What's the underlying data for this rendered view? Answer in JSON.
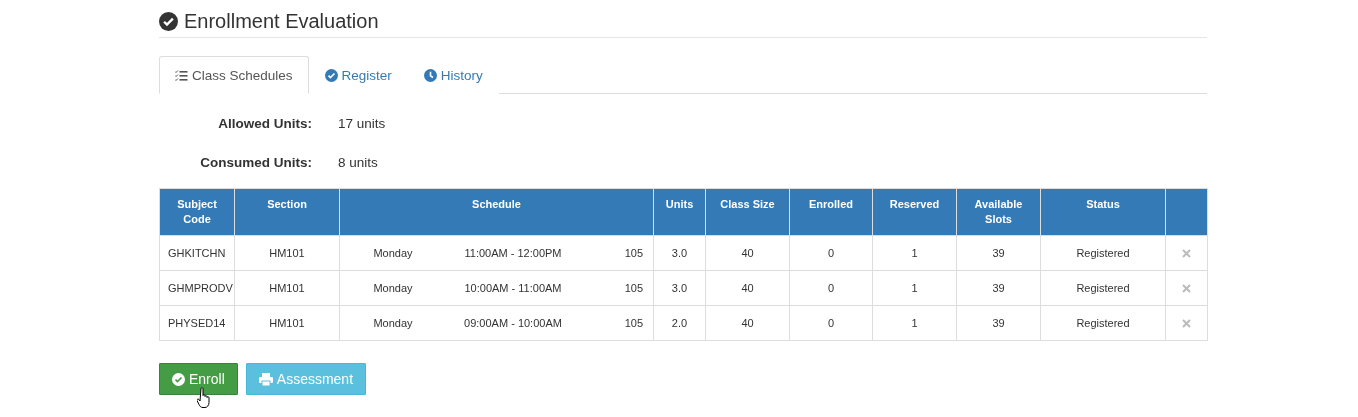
{
  "title": "Enrollment Evaluation",
  "tabs": [
    {
      "label": "Class Schedules",
      "kind": "list",
      "selected": true
    },
    {
      "label": "Register",
      "kind": "check",
      "selected": false
    },
    {
      "label": "History",
      "kind": "clock",
      "selected": false
    }
  ],
  "summary": [
    {
      "label": "Allowed Units:",
      "value": "17 units"
    },
    {
      "label": "Consumed Units:",
      "value": "8 units"
    }
  ],
  "table": {
    "columns": [
      "Subject Code",
      "Section",
      "Schedule",
      "Units",
      "Class Size",
      "Enrolled",
      "Reserved",
      "Available Slots",
      "Status"
    ],
    "rows": [
      {
        "subject_code": "GHKITCHN",
        "section": "HM101",
        "day": "Monday",
        "time": "11:00AM - 12:00PM",
        "room": "105",
        "units": "3.0",
        "class_size": "40",
        "enrolled": "0",
        "reserved": "1",
        "available_slots": "39",
        "status": "Registered"
      },
      {
        "subject_code": "GHMPRODV",
        "section": "HM101",
        "day": "Monday",
        "time": "10:00AM - 11:00AM",
        "room": "105",
        "units": "3.0",
        "class_size": "40",
        "enrolled": "0",
        "reserved": "1",
        "available_slots": "39",
        "status": "Registered"
      },
      {
        "subject_code": "PHYSED14",
        "section": "HM101",
        "day": "Monday",
        "time": "09:00AM - 10:00AM",
        "room": "105",
        "units": "2.0",
        "class_size": "40",
        "enrolled": "0",
        "reserved": "1",
        "available_slots": "39",
        "status": "Registered"
      }
    ]
  },
  "buttons": [
    {
      "label": "Enroll",
      "kind": "success"
    },
    {
      "label": "Assessment",
      "kind": "info"
    }
  ]
}
